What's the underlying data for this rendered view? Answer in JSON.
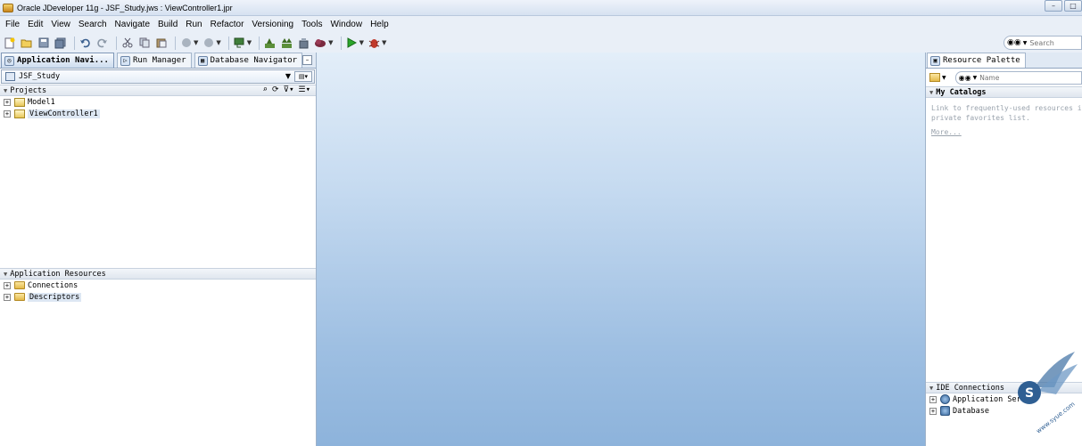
{
  "window": {
    "title": "Oracle JDeveloper 11g - JSF_Study.jws : ViewController1.jpr",
    "controls": [
      "–",
      "□"
    ]
  },
  "menu": [
    "File",
    "Edit",
    "View",
    "Search",
    "Navigate",
    "Build",
    "Run",
    "Refactor",
    "Versioning",
    "Tools",
    "Window",
    "Help"
  ],
  "toolbar": {
    "search_placeholder": "Search",
    "icons": [
      "new-icon",
      "open-icon",
      "save-icon",
      "save-all-icon",
      "undo-icon",
      "redo-icon",
      "cut-icon",
      "copy-icon",
      "paste-icon",
      "back-icon",
      "forward-icon",
      "template-icon",
      "make-icon",
      "rebuild-icon",
      "deploy-icon",
      "cloud-icon",
      "run-icon",
      "debug-icon"
    ]
  },
  "left_panel": {
    "tabs": [
      {
        "label": "Application Navi...",
        "active": true
      },
      {
        "label": "Run Manager",
        "active": false
      },
      {
        "label": "Database Navigator",
        "active": false
      }
    ],
    "application": "JSF_Study",
    "projects_header": "Projects",
    "projects": [
      {
        "label": "Model1",
        "selected": false
      },
      {
        "label": "ViewController1",
        "selected": true
      }
    ],
    "resources_header": "Application Resources",
    "resources": [
      {
        "label": "Connections",
        "selected": false
      },
      {
        "label": "Descriptors",
        "selected": true
      }
    ]
  },
  "right_panel": {
    "tab": "Resource Palette",
    "search_placeholder": "Name",
    "catalogs_header": "My Catalogs",
    "catalogs_text_1": "Link to frequently-used resources in a",
    "catalogs_text_2": "private favorites list.",
    "more_link": "More...",
    "ide_header": "IDE Connections",
    "ide_items": [
      "Application Server",
      "Database"
    ]
  },
  "watermark": {
    "text": "www.syue.com"
  },
  "colors": {
    "editor_top": "#e3eef9",
    "editor_bottom": "#8db3db",
    "selection": "#dde7f3"
  }
}
